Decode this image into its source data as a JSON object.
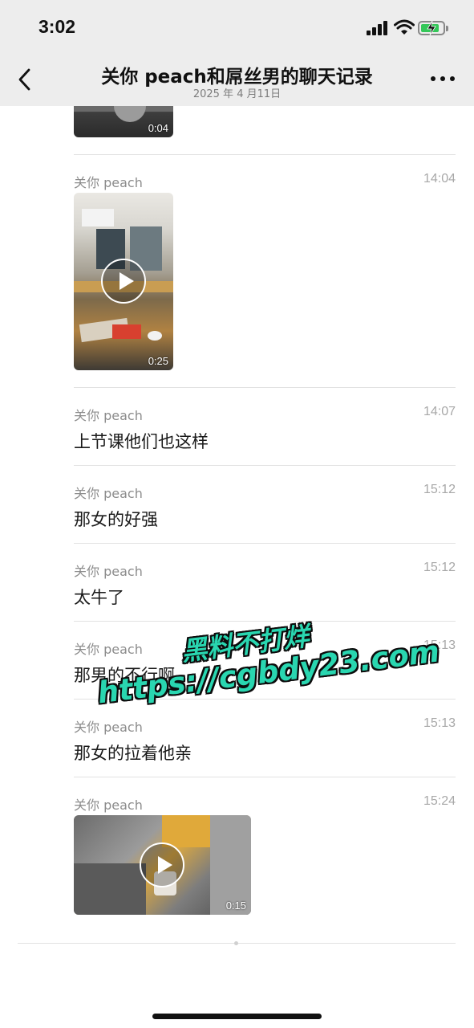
{
  "status_bar": {
    "time": "3:02"
  },
  "nav": {
    "title": "关你 peach和屌丝男的聊天记录",
    "subtitle": "2025 年 4 月11日"
  },
  "messages": [
    {
      "type": "video",
      "duration": "0:04"
    },
    {
      "type": "video",
      "sender": "关你 peach",
      "time": "14:04",
      "duration": "0:25"
    },
    {
      "type": "text",
      "sender": "关你 peach",
      "time": "14:07",
      "text": "上节课他们也这样"
    },
    {
      "type": "text",
      "sender": "关你 peach",
      "time": "15:12",
      "text": "那女的好强"
    },
    {
      "type": "text",
      "sender": "关你 peach",
      "time": "15:12",
      "text": "太牛了"
    },
    {
      "type": "text",
      "sender": "关你 peach",
      "time": "15:13",
      "text": "那男的不行啊"
    },
    {
      "type": "text",
      "sender": "关你 peach",
      "time": "15:13",
      "text": "那女的拉着他亲"
    },
    {
      "type": "video",
      "sender": "关你 peach",
      "time": "15:24",
      "duration": "0:15"
    }
  ],
  "watermark": {
    "line1": "黑料不打烊",
    "line2": "https://cgbdy23.com"
  },
  "colors": {
    "nav_bg": "#ededed",
    "sender": "#8c8c8c",
    "timestamp": "#a8a8a8",
    "watermark": "#29d6b0",
    "battery": "#34c759"
  },
  "icons": [
    "back-chevron-icon",
    "more-icon",
    "signal-icon",
    "wifi-icon",
    "battery-charging-icon",
    "play-icon"
  ]
}
